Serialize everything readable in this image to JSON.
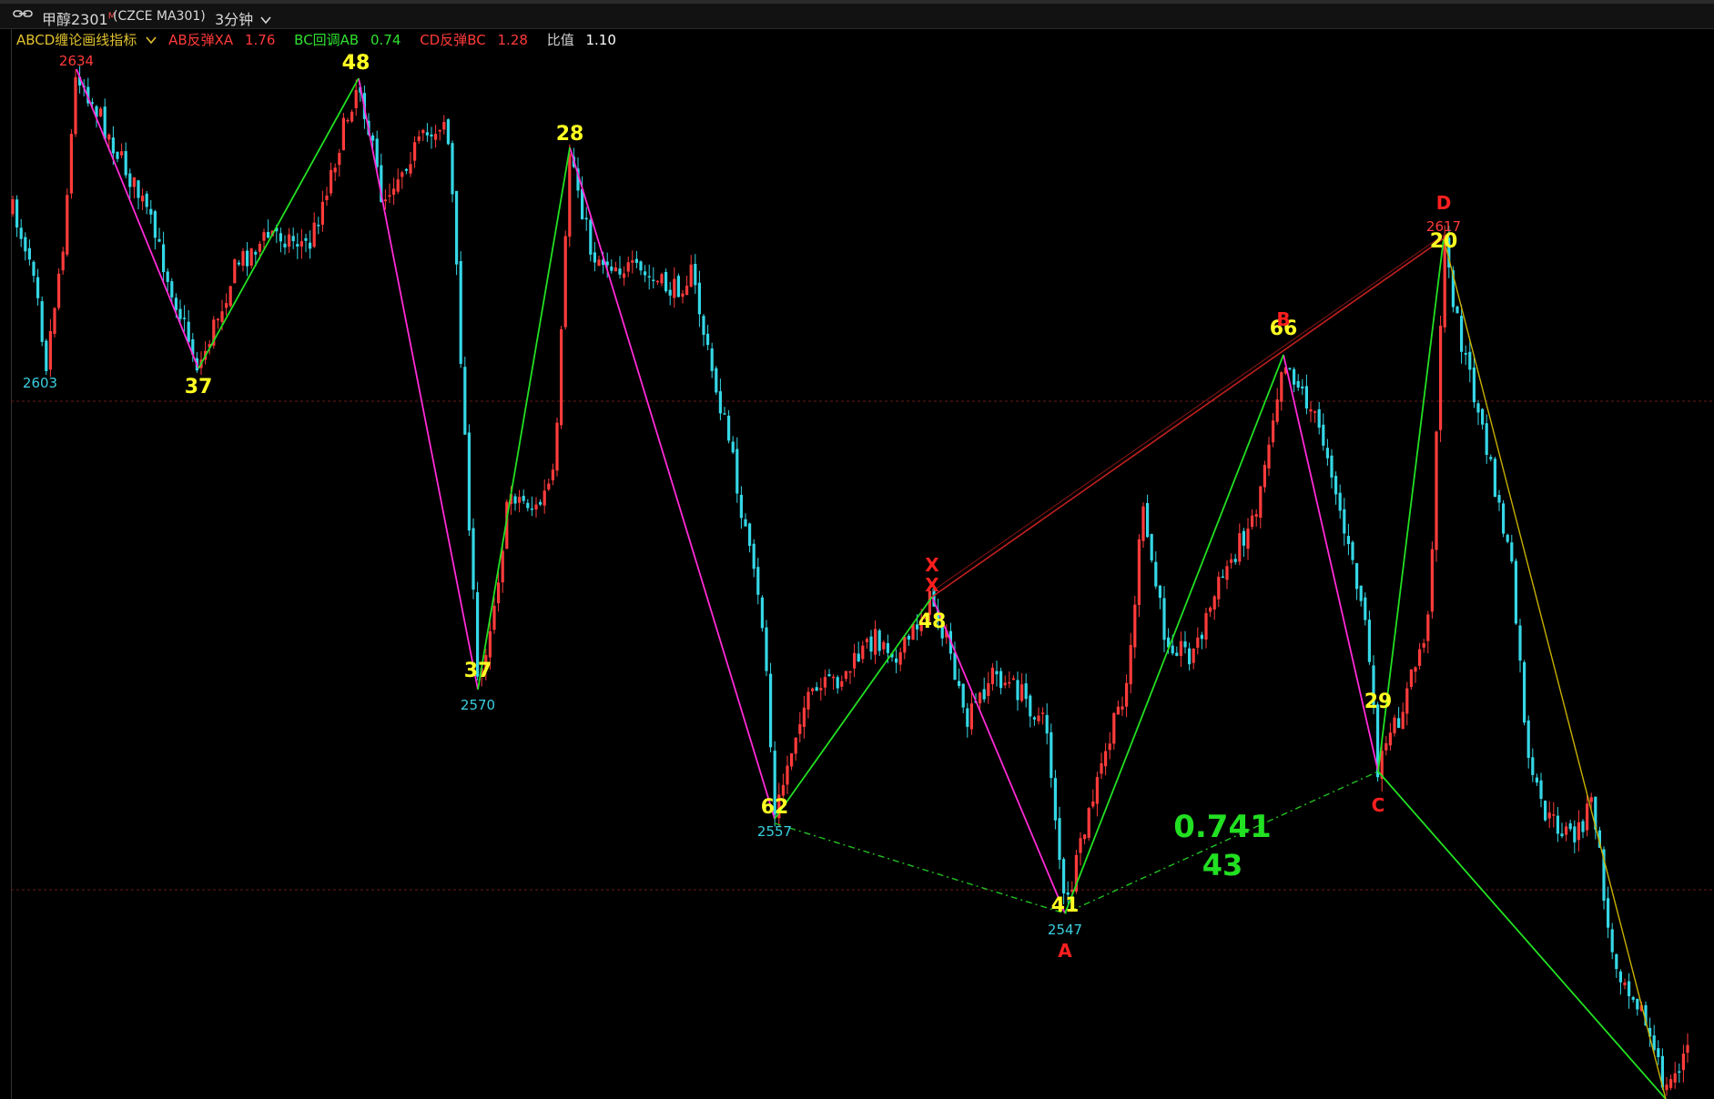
{
  "title_bar": {
    "link_icon": "chain-link-icon",
    "symbol": "甲醇2301",
    "symbol_sup": "M",
    "code": "(CZCE MA301)",
    "period": "3分钟",
    "dropdown_icon": "chevron-down-icon"
  },
  "legend": {
    "indicator_name": "ABCD缠论画线指标",
    "ab_label": "AB反弹XA",
    "ab_value": "1.76",
    "bc_label": "BC回调AB",
    "bc_value": "0.74",
    "cd_label": "CD反弹BC",
    "cd_value": "1.28",
    "ratio_label": "比值",
    "ratio_value": "1.10"
  },
  "colors": {
    "up": "#ff3b3b",
    "down": "#35d7e6",
    "green": "#22e022",
    "magenta": "#ff2bd6",
    "yellow": "#ffff22",
    "red": "#ff1f1f",
    "cyan_text": "#39d0e0",
    "olive": "#c8b000"
  },
  "chart_data": {
    "type": "candlestick",
    "series": [
      {
        "name": "candles",
        "values": []
      }
    ],
    "pivots": [
      {
        "label": "48",
        "time": 0.0
      },
      {
        "label": "2634",
        "time": 0.045
      },
      {
        "label": "37",
        "time": 0.115
      },
      {
        "label": "48",
        "time": 0.21
      },
      {
        "label": "37",
        "time": 0.28
      },
      {
        "label": "2570",
        "time": 0.28
      },
      {
        "label": "28",
        "time": 0.333
      },
      {
        "label": "62",
        "time": 0.452
      },
      {
        "label": "2557",
        "time": 0.452
      },
      {
        "label": "48",
        "time": 0.545
      },
      {
        "label": "41",
        "time": 0.624
      },
      {
        "label": "2547",
        "time": 0.624
      },
      {
        "label": "66",
        "time": 0.75
      },
      {
        "label": "29",
        "time": 0.805
      },
      {
        "label": "20",
        "time": 0.845
      },
      {
        "label": "2617",
        "time": 0.845
      },
      {
        "label": "2603",
        "time": 0.025
      }
    ],
    "pattern_letters": [
      "X",
      "X",
      "A",
      "B",
      "C",
      "D"
    ],
    "ratio_text": "0.741",
    "ratio_count": "43"
  }
}
